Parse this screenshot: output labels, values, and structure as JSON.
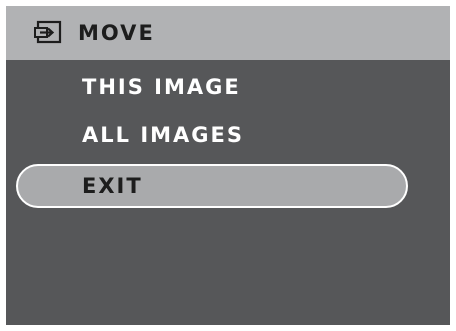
{
  "header": {
    "title": "MOVE",
    "icon": "move-icon"
  },
  "menu": {
    "items": [
      {
        "label": "THIS IMAGE",
        "selected": false
      },
      {
        "label": "ALL IMAGES",
        "selected": false
      },
      {
        "label": "EXIT",
        "selected": true
      }
    ]
  },
  "colors": {
    "screen_background": "#565759",
    "header_background": "#b1b2b4",
    "selected_background": "#a9aaac",
    "selected_border": "#ffffff",
    "text_light": "#ffffff",
    "text_dark": "#1d1d1d"
  }
}
